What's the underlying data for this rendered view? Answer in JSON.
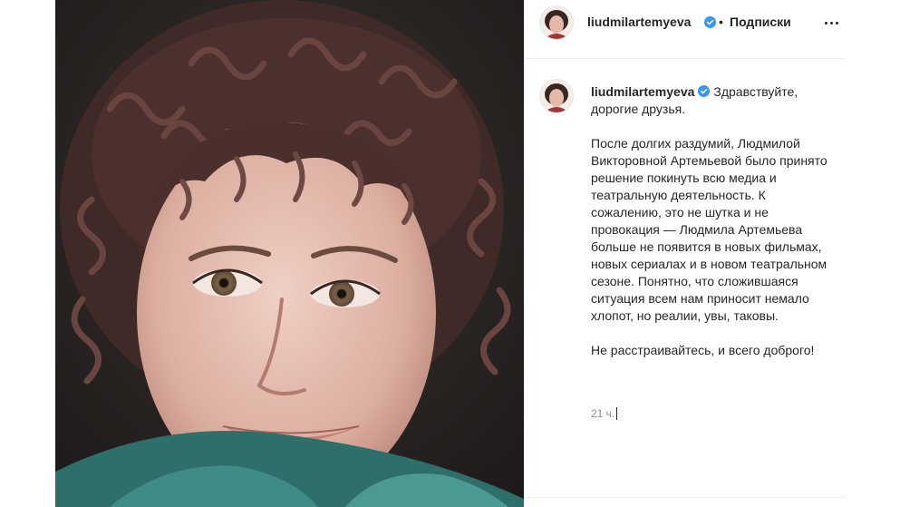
{
  "post": {
    "username": "liudmilartemyeva",
    "follow_status": "Подписки",
    "separator": "•",
    "caption": {
      "greeting": "Здравствуйте, дорогие друзья.",
      "body": "После долгих раздумий, Людмилой Викторовной Артемьевой было принято решение покинуть всю медиа и театральную деятельность. К сожалению, это не шутка и не провокация — Людмила Артемьева больше не появится в новых фильмах, новых сериалах и в новом театральном сезоне. Понятно, что сложившаяся ситуация всем нам приносит немало хлопот, но реалии, увы, таковы.",
      "closing": "Не расстраивайтесь, и всего доброго!"
    },
    "time_ago": "21 ч."
  },
  "icons": {
    "verified": "verified-badge-icon",
    "more": "more-options-icon"
  },
  "colors": {
    "verified": "#3897f0",
    "text": "#262626",
    "muted": "#8e8e8e",
    "divider": "#efefef"
  }
}
